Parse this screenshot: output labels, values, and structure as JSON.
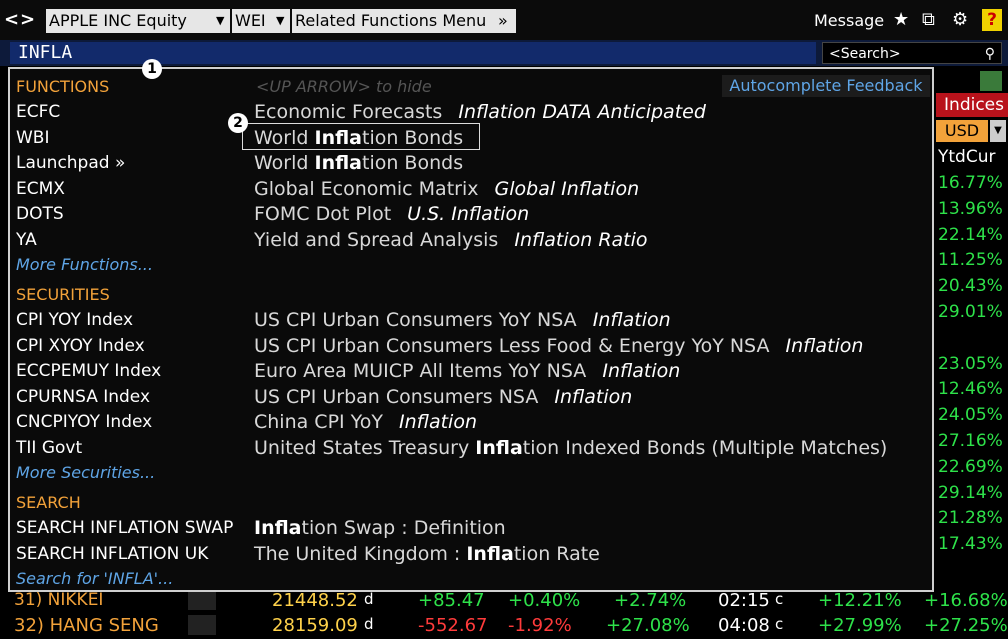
{
  "toolbar": {
    "back": "<",
    "forward": ">",
    "security": "APPLE INC Equity",
    "function": "WEI",
    "related": "Related Functions Menu",
    "related_caret": "»",
    "message": "Message",
    "help": "?"
  },
  "command": {
    "value": "INFLA",
    "search_placeholder": "<Search>"
  },
  "panel": {
    "hint": "<UP ARROW> to hide",
    "feedback": "Autocomplete Feedback",
    "functions_head": "FUNCTIONS",
    "functions": [
      {
        "code": "ECFC",
        "pre": "Economic Forecasts",
        "bold": "",
        "post": "",
        "tag": "Inflation DATA Anticipated"
      },
      {
        "code": "WBI",
        "pre": "World ",
        "bold": "Infla",
        "post": "tion Bonds",
        "tag": ""
      },
      {
        "code": "Launchpad »",
        "pre": "World ",
        "bold": "Infla",
        "post": "tion Bonds",
        "tag": ""
      },
      {
        "code": "ECMX",
        "pre": "Global Economic Matrix",
        "bold": "",
        "post": "",
        "tag": "Global Inflation"
      },
      {
        "code": "DOTS",
        "pre": "FOMC Dot Plot",
        "bold": "",
        "post": "",
        "tag": "U.S. Inflation"
      },
      {
        "code": "YA",
        "pre": "Yield and Spread Analysis",
        "bold": "",
        "post": "",
        "tag": "Inflation Ratio"
      }
    ],
    "more_functions": "More Functions...",
    "securities_head": "SECURITIES",
    "securities": [
      {
        "code": "CPI YOY Index",
        "pre": "US CPI Urban Consumers YoY NSA",
        "bold": "",
        "post": "",
        "tag": "Inflation"
      },
      {
        "code": "CPI XYOY Index",
        "pre": "US CPI Urban Consumers Less Food & Energy YoY NSA",
        "bold": "",
        "post": "",
        "tag": "Inflation"
      },
      {
        "code": "ECCPEMUY Index",
        "pre": "Euro Area MUICP All Items YoY NSA",
        "bold": "",
        "post": "",
        "tag": "Inflation"
      },
      {
        "code": "CPURNSA Index",
        "pre": "US CPI Urban Consumers NSA",
        "bold": "",
        "post": "",
        "tag": "Inflation"
      },
      {
        "code": "CNCPIYOY Index",
        "pre": "China CPI YoY",
        "bold": "",
        "post": "",
        "tag": "Inflation"
      },
      {
        "code": "TII Govt",
        "pre": "United States Treasury ",
        "bold": "Infla",
        "post": "tion Indexed Bonds (Multiple Matches)",
        "tag": ""
      }
    ],
    "more_securities": "More Securities...",
    "search_head": "SEARCH",
    "searches": [
      {
        "code": "SEARCH INFLATION SWAP",
        "pre": "",
        "bold": "Infla",
        "post": "tion Swap : Definition",
        "tag": ""
      },
      {
        "code": "SEARCH INFLATION UK",
        "pre": "The United Kingdom : ",
        "bold": "Infla",
        "post": "tion Rate",
        "tag": ""
      }
    ],
    "search_for": "Search for 'INFLA'..."
  },
  "annotations": {
    "one": "1",
    "two": "2"
  },
  "background": {
    "indices_label": "Indices",
    "currency": "USD",
    "ytd_header": "YtdCur",
    "ytd_values": [
      "16.77%",
      "13.96%",
      "22.14%",
      "11.25%",
      "20.43%",
      "29.01%",
      "",
      "23.05%",
      "12.46%",
      "24.05%",
      "27.16%",
      "22.69%",
      "29.14%",
      "21.28%",
      "17.43%"
    ],
    "rows": [
      {
        "label": "31) NIKKEI",
        "last": "21448.52",
        "flag": "d",
        "chg": "+85.47",
        "pct": "+0.40%",
        "ytd": "+2.74%",
        "time": "02:15",
        "tflag": "c",
        "ytd2": "+12.21%",
        "ytdcur": "+16.68%"
      },
      {
        "label": "32) HANG SENG",
        "last": "28159.09",
        "flag": "d",
        "chg": "-552.67",
        "pct": "-1.92%",
        "ytd": "+27.08%",
        "time": "04:08",
        "tflag": "c",
        "ytd2": "+27.99%",
        "ytdcur": "+27.25%"
      }
    ]
  }
}
